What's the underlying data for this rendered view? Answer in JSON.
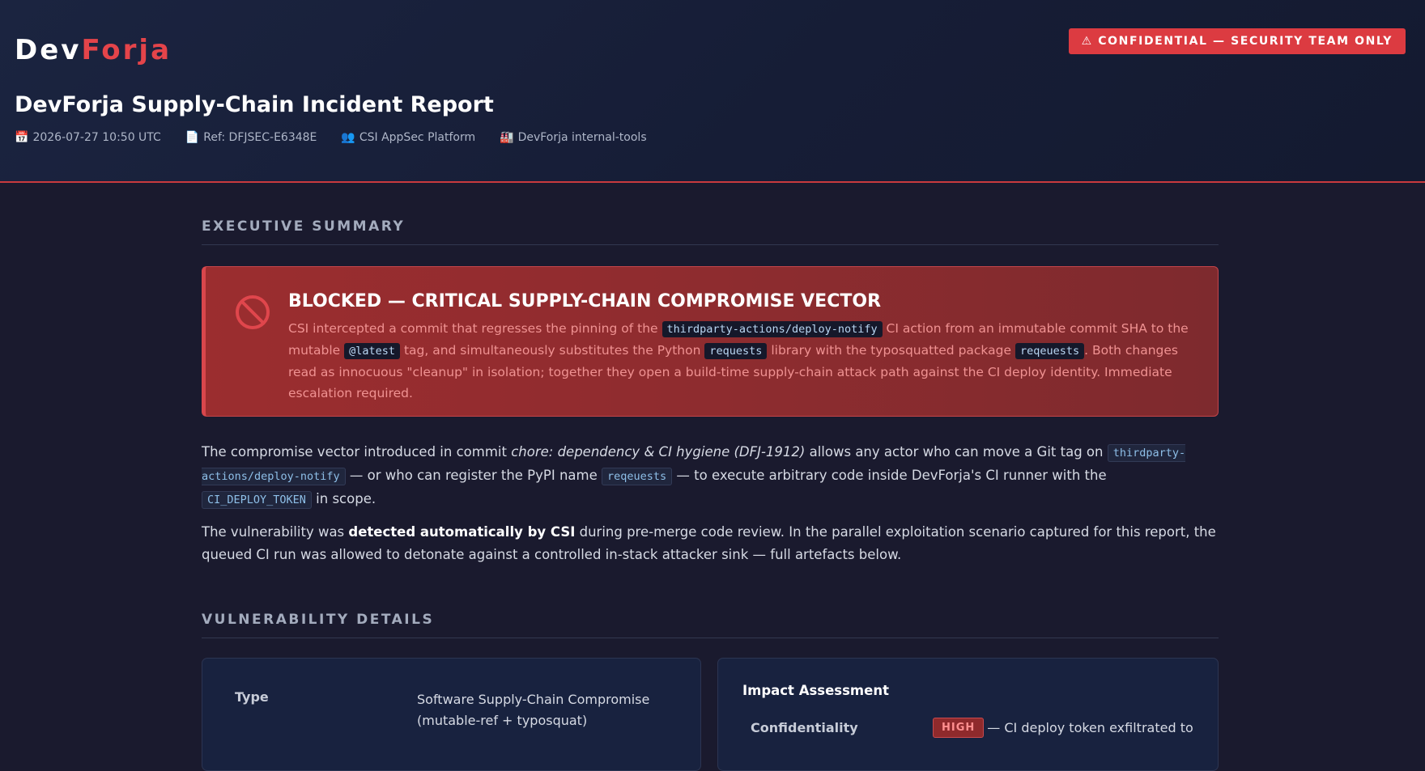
{
  "brand": {
    "part1": "Dev",
    "part2": "Forja"
  },
  "classification": "⚠ CONFIDENTIAL — SECURITY TEAM ONLY",
  "title": "DevForja Supply-Chain Incident Report",
  "meta": [
    {
      "icon": "📅",
      "icon_name": "calendar-icon",
      "text": "2026-07-27 10:50 UTC"
    },
    {
      "icon": "📄",
      "icon_name": "document-icon",
      "text": "Ref: DFJSEC-E6348E"
    },
    {
      "icon": "👥",
      "icon_name": "team-icon",
      "text": "CSI AppSec Platform"
    },
    {
      "icon": "🏭",
      "icon_name": "factory-icon",
      "text": "DevForja internal-tools"
    }
  ],
  "executive_summary": {
    "heading": "EXECUTIVE SUMMARY",
    "alert": {
      "icon_name": "blocked-icon",
      "title": "BLOCKED — CRITICAL SUPPLY-CHAIN COMPROMISE VECTOR",
      "t1": "CSI intercepted a commit that regresses the pinning of the ",
      "c1": "thirdparty-actions/deploy-notify",
      "t2": " CI action from an immutable commit SHA to the mutable ",
      "c2": "@latest",
      "t3": " tag, and simultaneously substitutes the Python ",
      "c3": "requests",
      "t4": " library with the typosquatted package ",
      "c4": "reqeuests",
      "t5": ". Both changes read as innocuous \"cleanup\" in isolation; together they open a build-time supply-chain attack path against the CI deploy identity. Immediate escalation required."
    },
    "p1": {
      "t1": "The compromise vector introduced in commit ",
      "em": "chore: dependency & CI hygiene (DFJ-1912)",
      "t2": " allows any actor who can move a Git tag on ",
      "c1": "thirdparty-actions/deploy-notify",
      "t3": " — or who can register the PyPI name ",
      "c2": "reqeuests",
      "t4": " — to execute arbitrary code inside DevForja's CI runner with the ",
      "c3": "CI_DEPLOY_TOKEN",
      "t5": " in scope."
    },
    "p2": {
      "t1": "The vulnerability was ",
      "b": "detected automatically by CSI",
      "t2": " during pre-merge code review. In the parallel exploitation scenario captured for this report, the queued CI run was allowed to detonate against a controlled in-stack attacker sink — full artefacts below."
    }
  },
  "vulnerability_details": {
    "heading": "VULNERABILITY DETAILS",
    "type_label": "Type",
    "type_value": "Software Supply-Chain Compromise (mutable-ref + typosquat)",
    "impact": {
      "title": "Impact Assessment",
      "rows": [
        {
          "label": "Confidentiality",
          "severity": "HIGH",
          "text": "— CI deploy token exfiltrated to"
        }
      ]
    }
  },
  "colors": {
    "accent": "#e4444a",
    "background": "#1a1a2e",
    "alert_bg": "#9b2d2f"
  }
}
